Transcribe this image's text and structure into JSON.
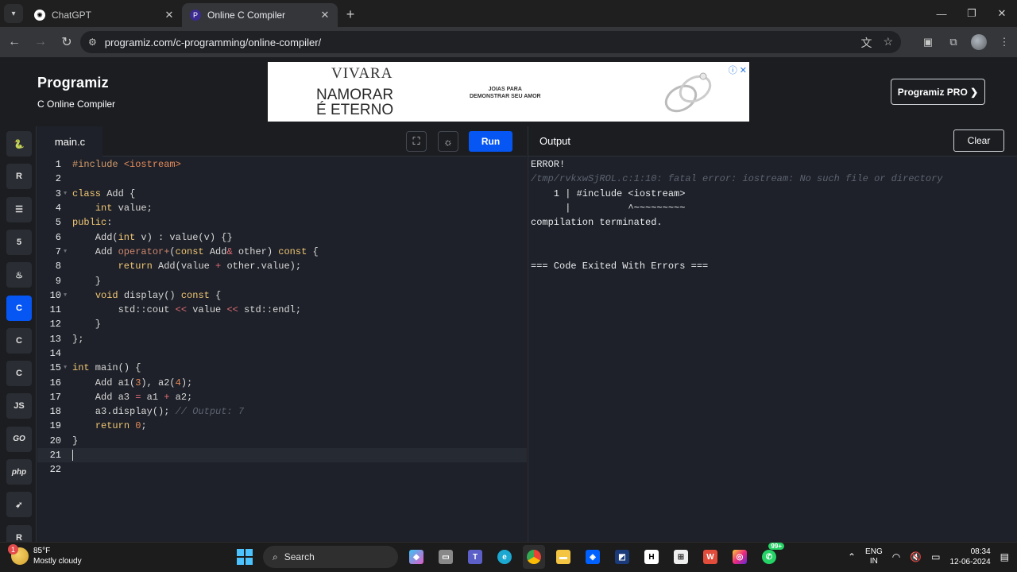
{
  "browser": {
    "tabs": [
      {
        "title": "ChatGPT",
        "active": false
      },
      {
        "title": "Online C Compiler",
        "active": true
      }
    ],
    "url": "programiz.com/c-programming/online-compiler/"
  },
  "site": {
    "logo": "Programiz",
    "subtitle": "C Online Compiler",
    "pro_button": "Programiz PRO ❯",
    "ad": {
      "brand": "VIVARA",
      "slogan_line1": "NAMORAR",
      "slogan_line2": "É ETERNO",
      "tagline_line1": "JOIAS PARA",
      "tagline_line2": "DEMONSTRAR SEU AMOR"
    }
  },
  "sidebar": {
    "languages": [
      {
        "name": "python-icon",
        "glyph": "🐍",
        "active": false
      },
      {
        "name": "r-icon",
        "glyph": "R",
        "active": false
      },
      {
        "name": "sql-icon",
        "glyph": "☰",
        "active": false
      },
      {
        "name": "html-icon",
        "glyph": "5",
        "active": false
      },
      {
        "name": "java-icon",
        "glyph": "♨",
        "active": false
      },
      {
        "name": "c-icon",
        "glyph": "C",
        "active": true
      },
      {
        "name": "cpp-icon",
        "glyph": "C",
        "active": false
      },
      {
        "name": "csharp-icon",
        "glyph": "C",
        "active": false
      },
      {
        "name": "js-icon",
        "glyph": "JS",
        "active": false
      },
      {
        "name": "go-icon",
        "glyph": "GO",
        "active": false
      },
      {
        "name": "php-icon",
        "glyph": "php",
        "active": false
      },
      {
        "name": "swift-icon",
        "glyph": "➶",
        "active": false
      },
      {
        "name": "rust-icon",
        "glyph": "R",
        "active": false
      }
    ]
  },
  "editor": {
    "filename": "main.c",
    "run_label": "Run",
    "lines": [
      {
        "n": "1",
        "fold": false,
        "html": "<span class='pp'>#include </span><span class='str'>&lt;iostream&gt;</span>"
      },
      {
        "n": "2",
        "fold": false,
        "html": ""
      },
      {
        "n": "3",
        "fold": true,
        "html": "<span class='k'>class</span> Add {"
      },
      {
        "n": "4",
        "fold": false,
        "html": "    <span class='k'>int</span> value;"
      },
      {
        "n": "5",
        "fold": false,
        "html": "<span class='k'>public</span>:"
      },
      {
        "n": "6",
        "fold": false,
        "html": "    Add(<span class='k'>int</span> v) : value(v) {}"
      },
      {
        "n": "7",
        "fold": true,
        "html": "    Add <span class='acc'>operator+</span>(<span class='k'>const</span> Add<span class='op'>&amp;</span> other) <span class='k'>const</span> {"
      },
      {
        "n": "8",
        "fold": false,
        "html": "        <span class='k'>return</span> Add(value <span class='op'>+</span> other.value);"
      },
      {
        "n": "9",
        "fold": false,
        "html": "    }"
      },
      {
        "n": "10",
        "fold": true,
        "html": "    <span class='k'>void</span> display() <span class='k'>const</span> {"
      },
      {
        "n": "11",
        "fold": false,
        "html": "        std::cout <span class='op'>&lt;&lt;</span> value <span class='op'>&lt;&lt;</span> std::endl;"
      },
      {
        "n": "12",
        "fold": false,
        "html": "    }"
      },
      {
        "n": "13",
        "fold": false,
        "html": "};"
      },
      {
        "n": "14",
        "fold": false,
        "html": ""
      },
      {
        "n": "15",
        "fold": true,
        "html": "<span class='k'>int</span> main() {"
      },
      {
        "n": "16",
        "fold": false,
        "html": "    Add a1(<span class='num'>3</span>), a2(<span class='num'>4</span>);"
      },
      {
        "n": "17",
        "fold": false,
        "html": "    Add a3 <span class='op'>=</span> a1 <span class='op'>+</span> a2;"
      },
      {
        "n": "18",
        "fold": false,
        "html": "    a3.display(); <span class='cm'>// Output: 7</span>"
      },
      {
        "n": "19",
        "fold": false,
        "html": "    <span class='k'>return</span> <span class='num'>0</span>;"
      },
      {
        "n": "20",
        "fold": false,
        "html": "}"
      },
      {
        "n": "21",
        "fold": false,
        "html": "",
        "current": true
      },
      {
        "n": "22",
        "fold": false,
        "html": ""
      }
    ]
  },
  "output": {
    "title": "Output",
    "clear_label": "Clear",
    "lines": [
      {
        "text": "ERROR!",
        "cls": ""
      },
      {
        "text": "/tmp/rvkxwSjROL.c:1:10: fatal error: iostream: No such file or directory",
        "cls": "err-path"
      },
      {
        "text": "    1 | #include <iostream>",
        "cls": ""
      },
      {
        "text": "      |          ^~~~~~~~~~",
        "cls": ""
      },
      {
        "text": "compilation terminated.",
        "cls": ""
      },
      {
        "text": "",
        "cls": ""
      },
      {
        "text": "",
        "cls": ""
      },
      {
        "text": "=== Code Exited With Errors ===",
        "cls": ""
      }
    ]
  },
  "taskbar": {
    "weather_badge": "1",
    "temperature": "85°F",
    "condition": "Mostly cloudy",
    "search_placeholder": "Search",
    "whatsapp_badge": "99+",
    "lang_line1": "ENG",
    "lang_line2": "IN",
    "time": "08:34",
    "date": "12-06-2024"
  }
}
